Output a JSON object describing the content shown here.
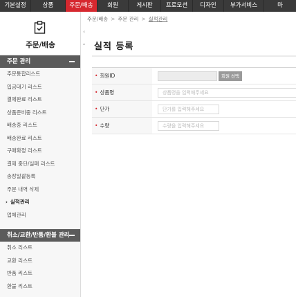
{
  "topnav": {
    "items": [
      {
        "label": "기본설정",
        "active": false
      },
      {
        "label": "상품",
        "active": false
      },
      {
        "label": "주문/배송",
        "active": true
      },
      {
        "label": "회원",
        "active": false
      },
      {
        "label": "게시판",
        "active": false
      },
      {
        "label": "프로모션",
        "active": false
      },
      {
        "label": "디자인",
        "active": false
      },
      {
        "label": "부가서비스",
        "active": false
      },
      {
        "label": "마",
        "active": false
      }
    ],
    "active_color": "#d6282f",
    "bg_color": "#3a3a3a"
  },
  "sidebar": {
    "icon": "clipboard-check-icon",
    "title": "주문/배송",
    "sections": [
      {
        "title": "주문 관리",
        "items": [
          "주문통합리스트",
          "입금대기 리스트",
          "결제완료 리스트",
          "상품준비중 리스트",
          "배송중 리스트",
          "배송완료 리스트",
          "구매확정 리스트",
          "결제 중단/실패 리스트",
          "송장일괄등록",
          "주문 내역 삭제",
          "실적관리",
          "업체관리"
        ],
        "active_item": "실적관리"
      },
      {
        "title": "취소/교환/반품/환불 관리",
        "items": [
          "취소 리스트",
          "교환 리스트",
          "반품 리스트",
          "환불 리스트"
        ]
      }
    ]
  },
  "breadcrumb": {
    "items": [
      "주문/배송",
      "주문 관리",
      "실적관리"
    ],
    "separator": ">"
  },
  "page": {
    "title": "실적 등록"
  },
  "form": {
    "member_id": {
      "label": "회원ID",
      "value": "",
      "button_label": "회원 선택"
    },
    "product_name": {
      "label": "상품명",
      "placeholder": "상품명을 입력해주세요"
    },
    "unit_price": {
      "label": "단가",
      "placeholder": "단가를 입력해주세요"
    },
    "quantity": {
      "label": "수량",
      "placeholder": "수량을 입력해주세요"
    }
  }
}
